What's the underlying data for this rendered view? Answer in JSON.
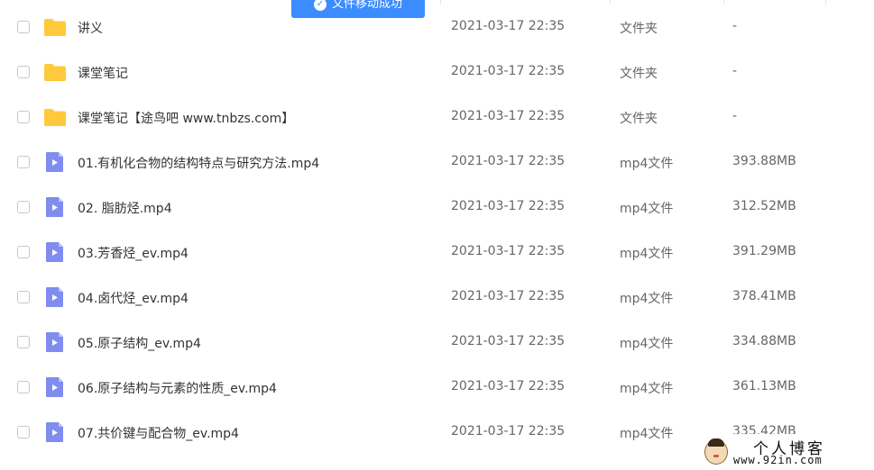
{
  "toast": {
    "text": "文件移动成功"
  },
  "files": [
    {
      "kind": "folder",
      "name": "讲义",
      "date": "2021-03-17 22:35",
      "type": "文件夹",
      "size": "-"
    },
    {
      "kind": "folder",
      "name": "课堂笔记",
      "date": "2021-03-17 22:35",
      "type": "文件夹",
      "size": "-"
    },
    {
      "kind": "folder",
      "name": "课堂笔记【途鸟吧 www.tnbzs.com】",
      "date": "2021-03-17 22:35",
      "type": "文件夹",
      "size": "-"
    },
    {
      "kind": "video",
      "name": "01.有机化合物的结构特点与研究方法.mp4",
      "date": "2021-03-17 22:35",
      "type": "mp4文件",
      "size": "393.88MB"
    },
    {
      "kind": "video",
      "name": "02. 脂肪烃.mp4",
      "date": "2021-03-17 22:35",
      "type": "mp4文件",
      "size": "312.52MB"
    },
    {
      "kind": "video",
      "name": "03.芳香烃_ev.mp4",
      "date": "2021-03-17 22:35",
      "type": "mp4文件",
      "size": "391.29MB"
    },
    {
      "kind": "video",
      "name": "04.卤代烃_ev.mp4",
      "date": "2021-03-17 22:35",
      "type": "mp4文件",
      "size": "378.41MB"
    },
    {
      "kind": "video",
      "name": "05.原子结构_ev.mp4",
      "date": "2021-03-17 22:35",
      "type": "mp4文件",
      "size": "334.88MB"
    },
    {
      "kind": "video",
      "name": "06.原子结构与元素的性质_ev.mp4",
      "date": "2021-03-17 22:35",
      "type": "mp4文件",
      "size": "361.13MB"
    },
    {
      "kind": "video",
      "name": "07.共价键与配合物_ev.mp4",
      "date": "2021-03-17 22:35",
      "type": "mp4文件",
      "size": "335.42MB"
    }
  ],
  "icons": {
    "folder": "folder-icon",
    "video": "video-file-icon"
  },
  "colors": {
    "folder": "#ffc93c",
    "video": "#7f8cf0",
    "toast": "#3b8cff"
  },
  "watermark": {
    "title": "个人博客",
    "url": "www.92in.com"
  }
}
